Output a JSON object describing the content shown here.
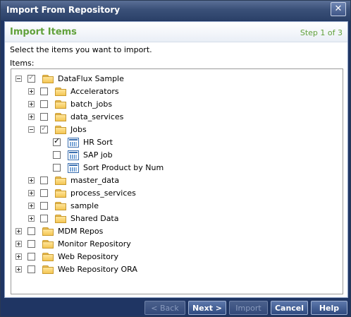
{
  "window": {
    "title": "Import From Repository",
    "close_glyph": "✕"
  },
  "header": {
    "title": "Import Items",
    "step": "Step 1 of 3"
  },
  "instructions": "Select the items you want to import.",
  "items_label": "Items:",
  "tree": [
    {
      "label": "DataFlux Sample",
      "level": 0,
      "expander": "minus",
      "check": "partial",
      "icon": "folder"
    },
    {
      "label": "Accelerators",
      "level": 1,
      "expander": "plus",
      "check": "none",
      "icon": "folder"
    },
    {
      "label": "batch_jobs",
      "level": 1,
      "expander": "plus",
      "check": "none",
      "icon": "folder"
    },
    {
      "label": "data_services",
      "level": 1,
      "expander": "plus",
      "check": "none",
      "icon": "folder"
    },
    {
      "label": "Jobs",
      "level": 1,
      "expander": "minus",
      "check": "partial",
      "icon": "folder"
    },
    {
      "label": "HR Sort",
      "level": 2,
      "expander": "none",
      "check": "checked",
      "icon": "job"
    },
    {
      "label": "SAP job",
      "level": 2,
      "expander": "none",
      "check": "none",
      "icon": "job"
    },
    {
      "label": "Sort Product by Num",
      "level": 2,
      "expander": "none",
      "check": "none",
      "icon": "job"
    },
    {
      "label": "master_data",
      "level": 1,
      "expander": "plus",
      "check": "none",
      "icon": "folder"
    },
    {
      "label": "process_services",
      "level": 1,
      "expander": "plus",
      "check": "none",
      "icon": "folder"
    },
    {
      "label": "sample",
      "level": 1,
      "expander": "plus",
      "check": "none",
      "icon": "folder"
    },
    {
      "label": "Shared Data",
      "level": 1,
      "expander": "plus",
      "check": "none",
      "icon": "folder"
    },
    {
      "label": "MDM Repos",
      "level": 0,
      "expander": "plus",
      "check": "none",
      "icon": "folder"
    },
    {
      "label": "Monitor Repository",
      "level": 0,
      "expander": "plus",
      "check": "none",
      "icon": "folder"
    },
    {
      "label": "Web Repository",
      "level": 0,
      "expander": "plus",
      "check": "none",
      "icon": "folder"
    },
    {
      "label": "Web Repository ORA",
      "level": 0,
      "expander": "plus",
      "check": "none",
      "icon": "folder"
    }
  ],
  "buttons": {
    "back": "< Back",
    "next": "Next >",
    "import": "Import",
    "cancel": "Cancel",
    "help": "Help"
  },
  "colors": {
    "accent_green": "#61a13b",
    "titlebar": "#3a5078",
    "button": "#2f4a80"
  }
}
